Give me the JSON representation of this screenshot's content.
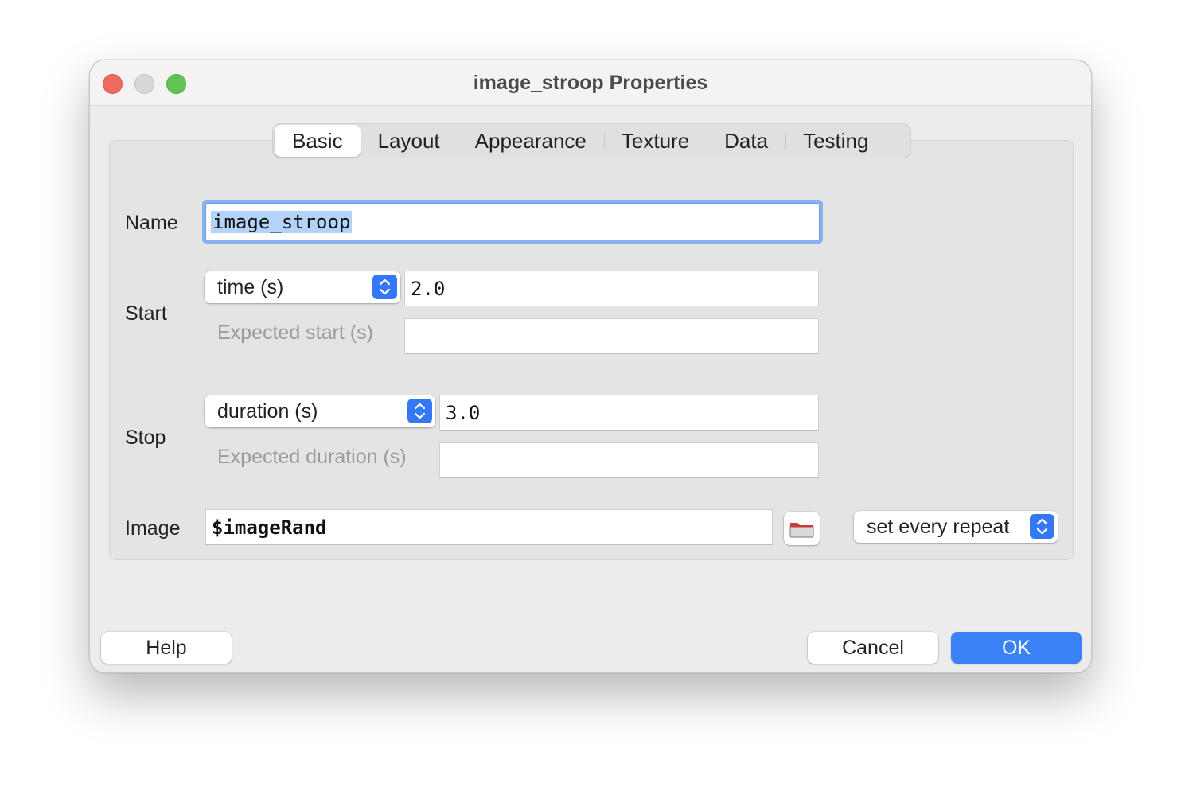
{
  "window": {
    "title": "image_stroop Properties"
  },
  "tabs": [
    {
      "label": "Basic",
      "active": true
    },
    {
      "label": "Layout",
      "active": false
    },
    {
      "label": "Appearance",
      "active": false
    },
    {
      "label": "Texture",
      "active": false
    },
    {
      "label": "Data",
      "active": false
    },
    {
      "label": "Testing",
      "active": false
    }
  ],
  "form": {
    "name": {
      "label": "Name",
      "value": "image_stroop"
    },
    "start": {
      "label": "Start",
      "type_value": "time (s)",
      "value": "2.0",
      "expected_label": "Expected start (s)",
      "expected_value": ""
    },
    "stop": {
      "label": "Stop",
      "type_value": "duration (s)",
      "value": "3.0",
      "expected_label": "Expected duration (s)",
      "expected_value": ""
    },
    "image": {
      "label": "Image",
      "value": "$imageRand",
      "update_value": "set every repeat"
    }
  },
  "buttons": {
    "help": "Help",
    "cancel": "Cancel",
    "ok": "OK"
  },
  "colors": {
    "accent": "#3a82f6",
    "close": "#ed6a5e",
    "maximize": "#61c554",
    "selection": "#b3d3fb"
  }
}
